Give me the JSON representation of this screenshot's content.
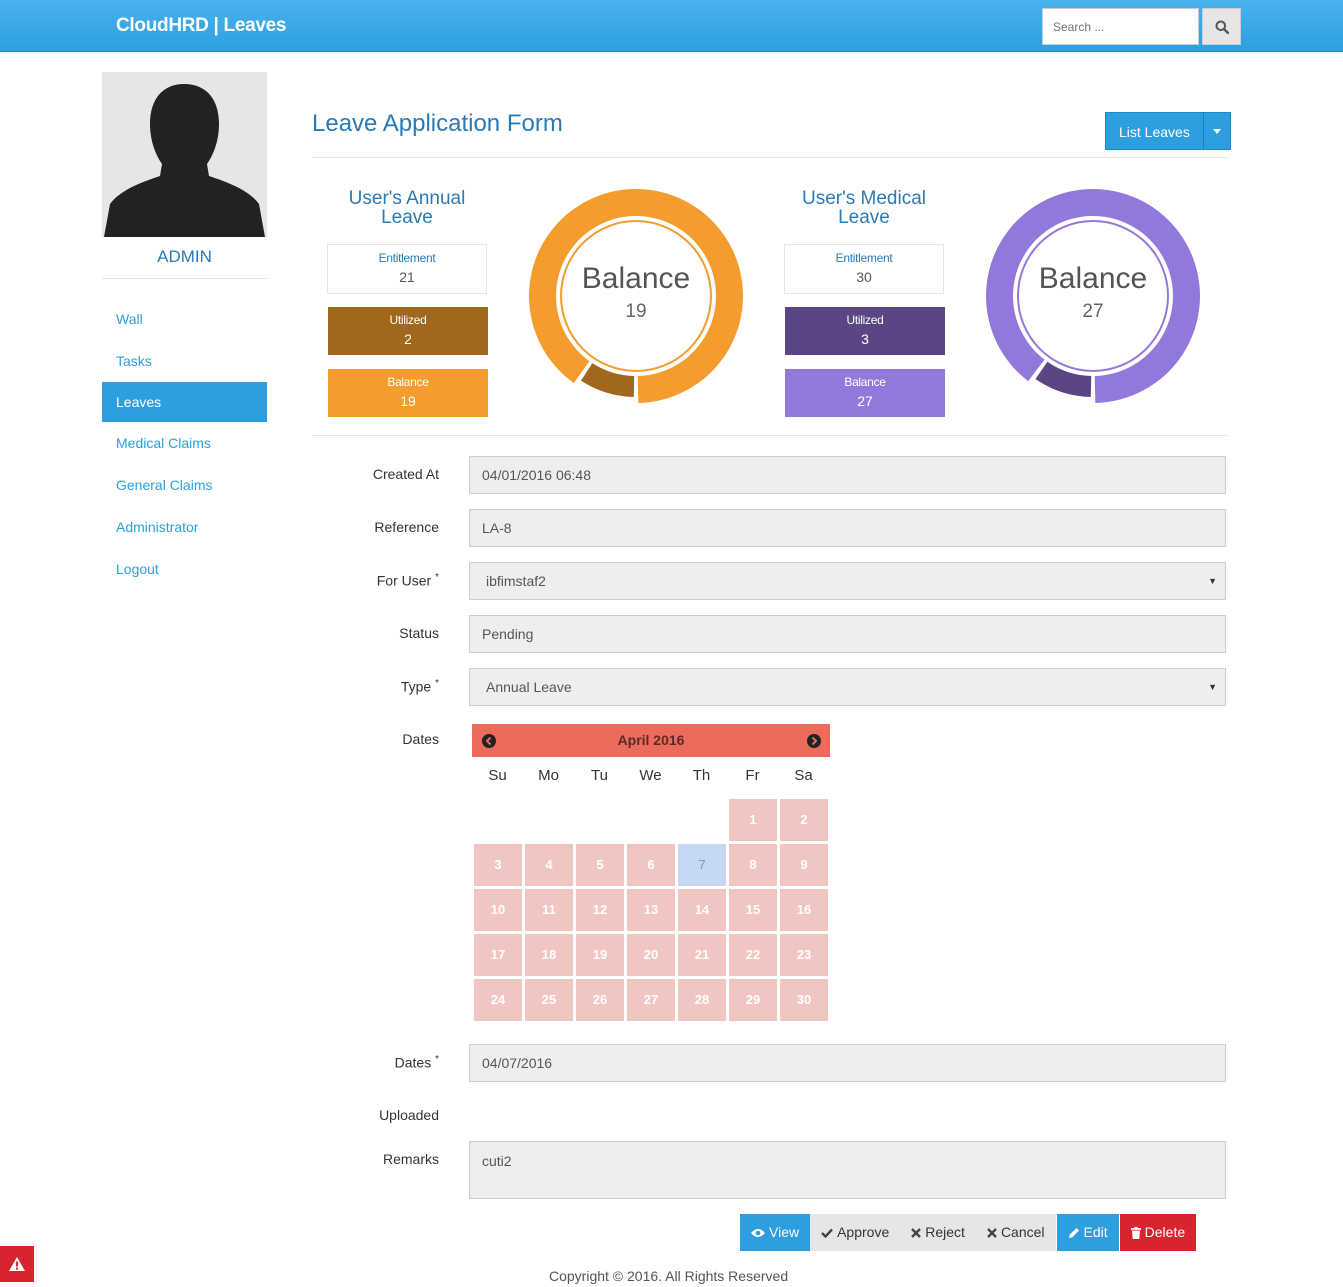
{
  "header": {
    "brand": "CloudHRD | Leaves",
    "search_placeholder": "Search ...",
    "search_icon": "search-icon"
  },
  "sidebar": {
    "username": "ADMIN",
    "items": [
      {
        "label": "Wall",
        "active": false
      },
      {
        "label": "Tasks",
        "active": false
      },
      {
        "label": "Leaves",
        "active": true
      },
      {
        "label": "Medical Claims",
        "active": false
      },
      {
        "label": "General Claims",
        "active": false
      },
      {
        "label": "Administrator",
        "active": false
      },
      {
        "label": "Logout",
        "active": false
      }
    ]
  },
  "page": {
    "title": "Leave Application Form",
    "list_button": "List Leaves"
  },
  "annual": {
    "title": "User's Annual Leave",
    "entitlement_label": "Entitlement",
    "entitlement": "21",
    "utilized_label": "Utilized",
    "utilized": "2",
    "balance_label": "Balance",
    "balance": "19",
    "donut_label": "Balance",
    "donut_value": "19",
    "colors": {
      "main": "#f49c2e",
      "used": "#a0671d"
    }
  },
  "medical": {
    "title": "User's Medical Leave",
    "entitlement_label": "Entitlement",
    "entitlement": "30",
    "utilized_label": "Utilized",
    "utilized": "3",
    "balance_label": "Balance",
    "balance": "27",
    "donut_label": "Balance",
    "donut_value": "27",
    "colors": {
      "main": "#9378db",
      "used": "#5c4585"
    }
  },
  "form": {
    "created_at_label": "Created At",
    "created_at": "04/01/2016 06:48",
    "reference_label": "Reference",
    "reference": "LA-8",
    "for_user_label": "For User",
    "for_user": "ibfimstaf2",
    "status_label": "Status",
    "status": "Pending",
    "type_label": "Type",
    "type": "Annual Leave",
    "dates_label": "Dates",
    "dates_field_label": "Dates",
    "dates_value": "04/07/2016",
    "uploaded_label": "Uploaded",
    "remarks_label": "Remarks",
    "remarks": "cuti2",
    "required_mark": "*"
  },
  "calendar": {
    "title": "April 2016",
    "weekdays": [
      "Su",
      "Mo",
      "Tu",
      "We",
      "Th",
      "Fr",
      "Sa"
    ],
    "first_weekday": 5,
    "days": 30,
    "selected_day": 7
  },
  "actions": {
    "view": "View",
    "approve": "Approve",
    "reject": "Reject",
    "cancel": "Cancel",
    "edit": "Edit",
    "delete": "Delete"
  },
  "footer": "Copyright © 2016. All Rights Reserved"
}
